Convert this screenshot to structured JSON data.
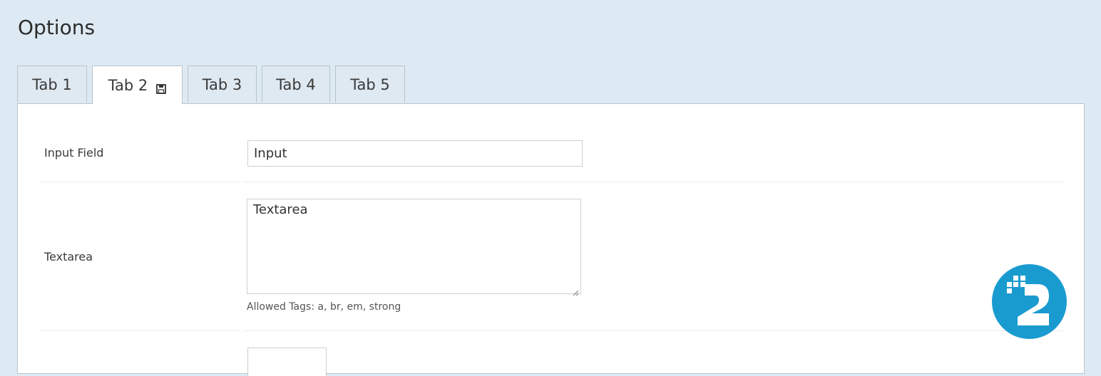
{
  "page": {
    "title": "Options"
  },
  "tabs": [
    {
      "label": "Tab 1",
      "active": false
    },
    {
      "label": "Tab 2",
      "active": true,
      "icon": "save-icon"
    },
    {
      "label": "Tab 3",
      "active": false
    },
    {
      "label": "Tab 4",
      "active": false
    },
    {
      "label": "Tab 5",
      "active": false
    }
  ],
  "fields": {
    "input": {
      "label": "Input Field",
      "value": "Input"
    },
    "textarea": {
      "label": "Textarea",
      "value": "Textarea",
      "help": "Allowed Tags: a, br, em, strong"
    }
  },
  "badge": {
    "icon": "logo-badge-icon",
    "color": "#1a9bd0"
  },
  "colors": {
    "background": "#deeaf3",
    "panel": "#ffffff",
    "border": "#b8c4cc"
  }
}
